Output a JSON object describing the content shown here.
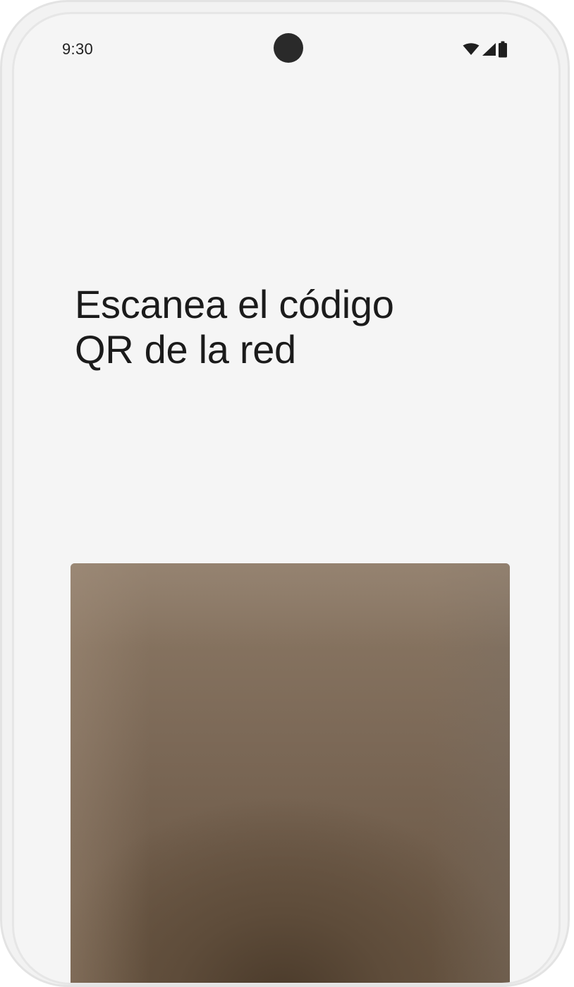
{
  "status_bar": {
    "time": "9:30",
    "icons": [
      "wifi-icon",
      "cellular-signal-icon",
      "battery-icon"
    ]
  },
  "screen": {
    "title_line1": "Escanea el código",
    "title_line2": "QR de la red"
  },
  "colors": {
    "background": "#f5f5f5",
    "text": "#1b1b1b",
    "camera_cutout": "#2a2a2a"
  }
}
